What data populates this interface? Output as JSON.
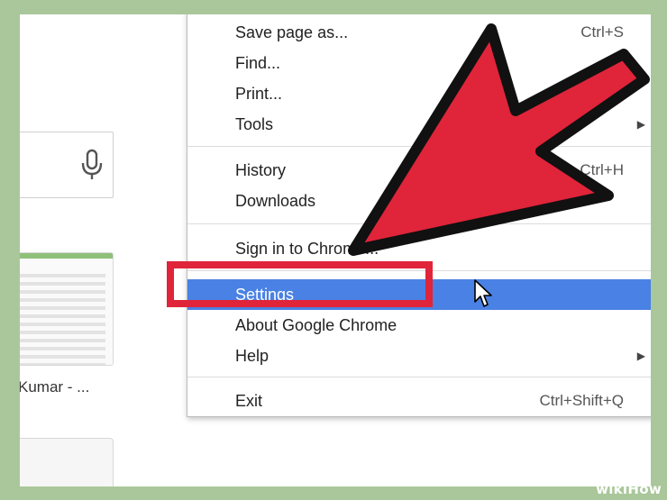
{
  "background": {
    "search_box": {
      "icon": "mic-icon"
    },
    "thumbnail_caption": "Kumar - ..."
  },
  "menu": {
    "items": [
      {
        "label": "Save page as...",
        "shortcut": "Ctrl+S"
      },
      {
        "label": "Find...",
        "shortcut": ""
      },
      {
        "label": "Print...",
        "shortcut": ""
      },
      {
        "label": "Tools",
        "submenu": "▶"
      },
      {
        "label": "History",
        "shortcut": "Ctrl+H"
      },
      {
        "label": "Downloads",
        "shortcut": ""
      },
      {
        "label": "Sign in to Chrome...",
        "shortcut": ""
      },
      {
        "label": "Settings",
        "highlighted": true
      },
      {
        "label": "About Google Chrome"
      },
      {
        "label": "Help",
        "submenu": "▶"
      },
      {
        "label": "Exit",
        "shortcut": "Ctrl+Shift+Q"
      }
    ]
  },
  "annotation": {
    "arrow_color": "#e0243a",
    "highlight_color": "#4a81e4",
    "box_color": "#e0243a"
  },
  "watermark": "wikiHow"
}
